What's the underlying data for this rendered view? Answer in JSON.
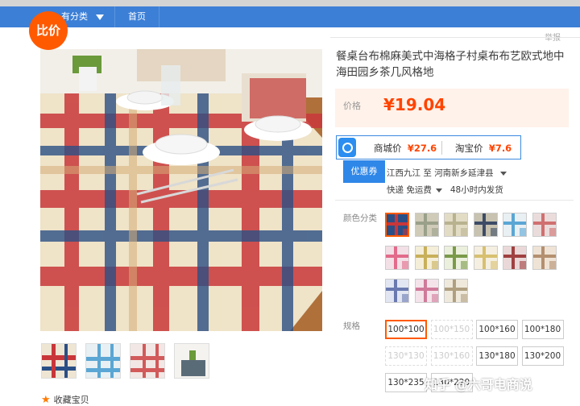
{
  "nav": {
    "category_label": "有分类",
    "home_label": "首页"
  },
  "badge": {
    "label": "比价"
  },
  "report_label": "举报",
  "product": {
    "title": "餐桌台布棉麻美式中海格子村桌布布艺欧式地中海田园乡茶几风格地",
    "price_label": "价格",
    "price": "¥19.04"
  },
  "compare": {
    "mall_label": "商城价",
    "mall_price": "¥27.6",
    "taobao_label": "淘宝价",
    "taobao_price": "¥7.6",
    "coupon_label": "优惠券"
  },
  "shipping": {
    "route_from": "江西九江",
    "route_to_word": "至",
    "route_to": "河南新乡延津县",
    "method": "快递 免运费",
    "dispatch": "48小时内发货"
  },
  "options": {
    "color_label": "颜色分类",
    "size_label": "规格",
    "sizes": [
      {
        "text": "100*100",
        "state": "selected"
      },
      {
        "text": "100*150",
        "state": "disabled"
      },
      {
        "text": "100*160",
        "state": "normal"
      },
      {
        "text": "100*180",
        "state": "normal"
      },
      {
        "text": "130*130",
        "state": "disabled"
      },
      {
        "text": "130*160",
        "state": "disabled"
      },
      {
        "text": "130*180",
        "state": "normal"
      },
      {
        "text": "130*200",
        "state": "normal"
      },
      {
        "text": "130*235",
        "state": "normal"
      },
      {
        "text": "130*220",
        "state": "normal"
      }
    ]
  },
  "favorite_label": "收藏宝贝",
  "watermark": "知乎 @六哥电商说",
  "colors": {
    "accent": "#ff5a00",
    "price": "#ff4400",
    "nav": "#3c7fd6",
    "coupon": "#2f87e8"
  }
}
